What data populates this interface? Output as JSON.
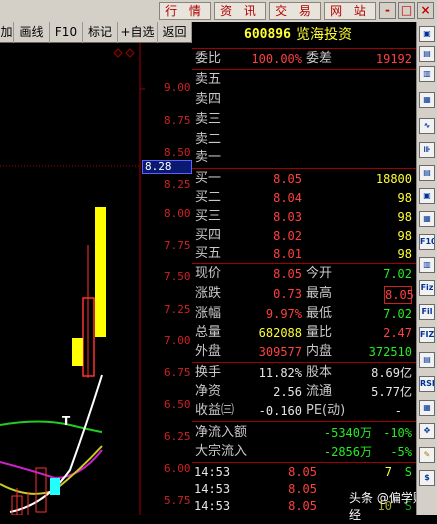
{
  "menu": {
    "items": [
      "行 情",
      "资 讯",
      "交 易",
      "网 站"
    ],
    "win_buttons": [
      "-",
      "□",
      "×"
    ]
  },
  "toolbar": {
    "items": [
      "加",
      "画线",
      "F10",
      "标记",
      "+自选",
      "返回"
    ]
  },
  "chart": {
    "y_ticks": [
      "9.00",
      "8.75",
      "8.50",
      "8.25",
      "8.00",
      "7.75",
      "7.50",
      "7.25",
      "7.00",
      "6.75",
      "6.50",
      "6.25",
      "6.00",
      "5.75"
    ],
    "price_tag": "8.28",
    "marker": "T"
  },
  "stock": {
    "code": "600896",
    "name": "览海投资"
  },
  "ratio": {
    "wb_label": "委比",
    "wb_value": "100.00%",
    "wc_label": "委差",
    "wc_value": "19192"
  },
  "sell_levels": [
    {
      "label": "卖五"
    },
    {
      "label": "卖四"
    },
    {
      "label": "卖三"
    },
    {
      "label": "卖二"
    },
    {
      "label": "卖一"
    }
  ],
  "buy_levels": [
    {
      "label": "买一",
      "price": "8.05",
      "vol": "18800"
    },
    {
      "label": "买二",
      "price": "8.04",
      "vol": "98"
    },
    {
      "label": "买三",
      "price": "8.03",
      "vol": "98"
    },
    {
      "label": "买四",
      "price": "8.02",
      "vol": "98"
    },
    {
      "label": "买五",
      "price": "8.01",
      "vol": "98"
    }
  ],
  "quote": {
    "xj_label": "现价",
    "xj": "8.05",
    "jk_label": "今开",
    "jk": "7.02",
    "zd_label": "涨跌",
    "zd": "0.73",
    "zg_label": "最高",
    "zg": "8.05",
    "zf_label": "涨幅",
    "zf": "9.97%",
    "zdi_label": "最低",
    "zdi": "7.02",
    "zl_label": "总量",
    "zl": "682088",
    "lb_label": "量比",
    "lb": "2.47",
    "wp_label": "外盘",
    "wp": "309577",
    "np_label": "内盘",
    "np": "372510"
  },
  "fund": {
    "hs_label": "换手",
    "hs": "11.82%",
    "gb_label": "股本",
    "gb": "8.69亿",
    "jz_label": "净资",
    "jz": "2.56",
    "lt_label": "流通",
    "lt": "5.77亿",
    "sy_label": "收益㈢",
    "sy": "-0.160",
    "pe_label": "PE(动)",
    "pe": "-"
  },
  "flow": {
    "jl_label": "净流入额",
    "jl_amt": "-5340万",
    "jl_pct": "-10%",
    "dz_label": "大宗流入",
    "dz_amt": "-2856万",
    "dz_pct": "-5%"
  },
  "ticks": [
    {
      "time": "14:53",
      "price": "8.05",
      "vol": "7",
      "dir": "S"
    },
    {
      "time": "14:53",
      "price": "8.05",
      "vol": "",
      "dir": ""
    },
    {
      "time": "14:53",
      "price": "8.05",
      "vol": "10",
      "dir": "S"
    }
  ],
  "sidebar_icons": [
    "box",
    "box",
    "box",
    "box",
    "chart",
    "chart",
    "box",
    "box",
    "box",
    "F10",
    "box",
    "Fiz",
    "Fil",
    "FIZ",
    "box",
    "RSI",
    "box",
    "move",
    "pen",
    "$"
  ],
  "watermark": "头条 @偏学财经",
  "colors": {
    "up": "#ff4040",
    "down": "#22ee22",
    "frame": "#a00000",
    "candle_up": "#ff3030",
    "candle_yellow": "#ffff00"
  }
}
